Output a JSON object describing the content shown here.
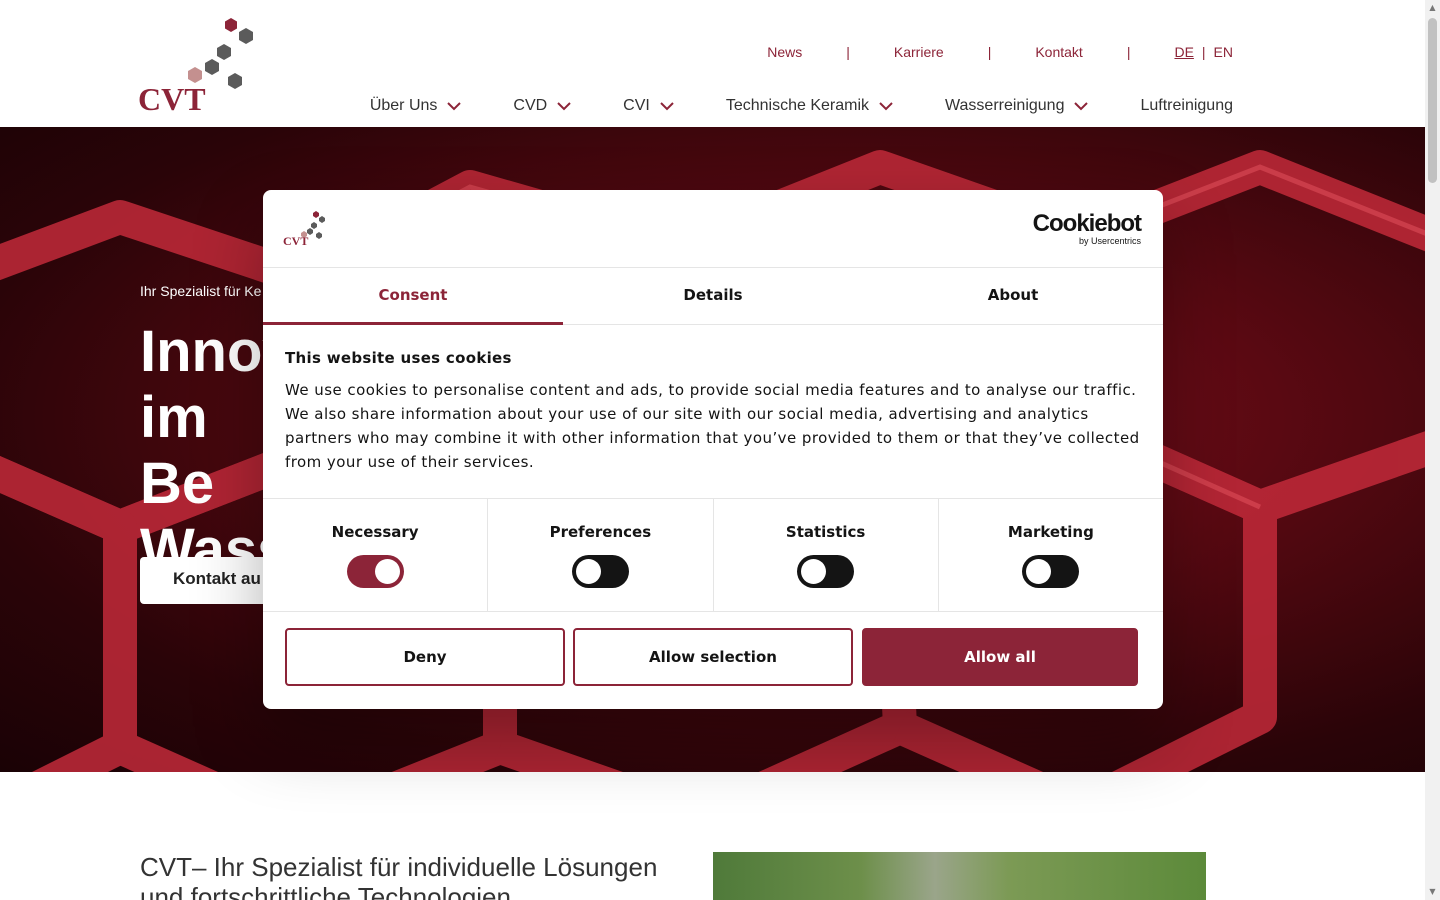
{
  "header": {
    "brand": "CVT",
    "top_nav": [
      "News",
      "Karriere",
      "Kontakt"
    ],
    "separator": "|",
    "languages": [
      "DE",
      "EN"
    ],
    "main_nav": [
      {
        "label": "Über Uns",
        "has_dropdown": true
      },
      {
        "label": "CVD",
        "has_dropdown": true
      },
      {
        "label": "CVI",
        "has_dropdown": true
      },
      {
        "label": "Technische Keramik",
        "has_dropdown": true
      },
      {
        "label": "Wasserreinigung",
        "has_dropdown": true
      },
      {
        "label": "Luftreinigung",
        "has_dropdown": false
      }
    ]
  },
  "hero": {
    "subtitle": "Ihr Spezialist für Ke",
    "title": "Innov\nim Be\nWass",
    "cta": "Kontakt au"
  },
  "intro": {
    "heading": "CVT– Ihr Spezialist für individuelle Lösungen und fortschrittliche Technologien"
  },
  "cookie_dialog": {
    "provider_main": "Cookiebot",
    "provider_sub": "by Usercentrics",
    "tabs": [
      "Consent",
      "Details",
      "About"
    ],
    "active_tab": "Consent",
    "title": "This website uses cookies",
    "text": "We use cookies to personalise content and ads, to provide social media features and to analyse our traf­fic. We also share information about your use of our site with our social media, advertising and analytics partners who may combine it with other information that you’ve provided to them or that they’ve col­lected from your use of their services.",
    "categories": [
      {
        "label": "Necessary",
        "on": true
      },
      {
        "label": "Preferences",
        "on": false
      },
      {
        "label": "Statistics",
        "on": false
      },
      {
        "label": "Marketing",
        "on": false
      }
    ],
    "buttons": {
      "deny": "Deny",
      "allow_selection": "Allow selection",
      "allow_all": "Allow all"
    }
  },
  "colors": {
    "brand": "#8c2438",
    "dark": "#141414"
  }
}
